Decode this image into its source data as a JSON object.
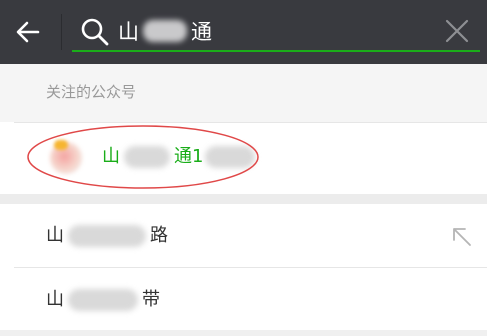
{
  "search": {
    "query_prefix": "山",
    "query_suffix": "通"
  },
  "section": {
    "title": "关注的公众号"
  },
  "account": {
    "name_prefix": "山",
    "name_middle": "通1"
  },
  "suggestions": [
    {
      "prefix": "山",
      "suffix": "路"
    },
    {
      "prefix": "山",
      "suffix": "带"
    }
  ],
  "colors": {
    "topbar": "#393a3f",
    "accent_green": "#1aad19",
    "annotation_red": "#e04848"
  }
}
